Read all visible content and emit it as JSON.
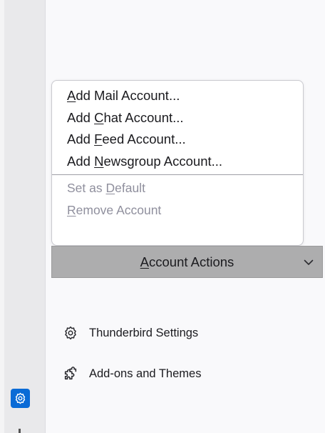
{
  "menu": {
    "items": [
      {
        "pre": "",
        "key": "A",
        "post": "dd Mail Account...",
        "disabled": false
      },
      {
        "pre": "Add ",
        "key": "C",
        "post": "hat Account...",
        "disabled": false
      },
      {
        "pre": "Add ",
        "key": "F",
        "post": "eed Account...",
        "disabled": false
      },
      {
        "pre": "Add ",
        "key": "N",
        "post": "ewsgroup Account...",
        "disabled": false
      }
    ],
    "disabled_items": [
      {
        "pre": "Set as ",
        "key": "D",
        "post": "efault",
        "disabled": true
      },
      {
        "pre": "",
        "key": "R",
        "post": "emove Account",
        "disabled": true
      }
    ]
  },
  "account_actions": {
    "pre": "",
    "key": "A",
    "post": "ccount Actions"
  },
  "links": {
    "settings": "Thunderbird Settings",
    "addons": "Add-ons and Themes"
  },
  "icons": {
    "settings": "gear-icon",
    "addons": "puzzle-icon",
    "chevron": "chevron-down-icon",
    "sidebar": "gear-icon"
  },
  "colors": {
    "accent": "#0a6bd6",
    "button_bg": "#adadae",
    "disabled_text": "#8f8f9d"
  }
}
